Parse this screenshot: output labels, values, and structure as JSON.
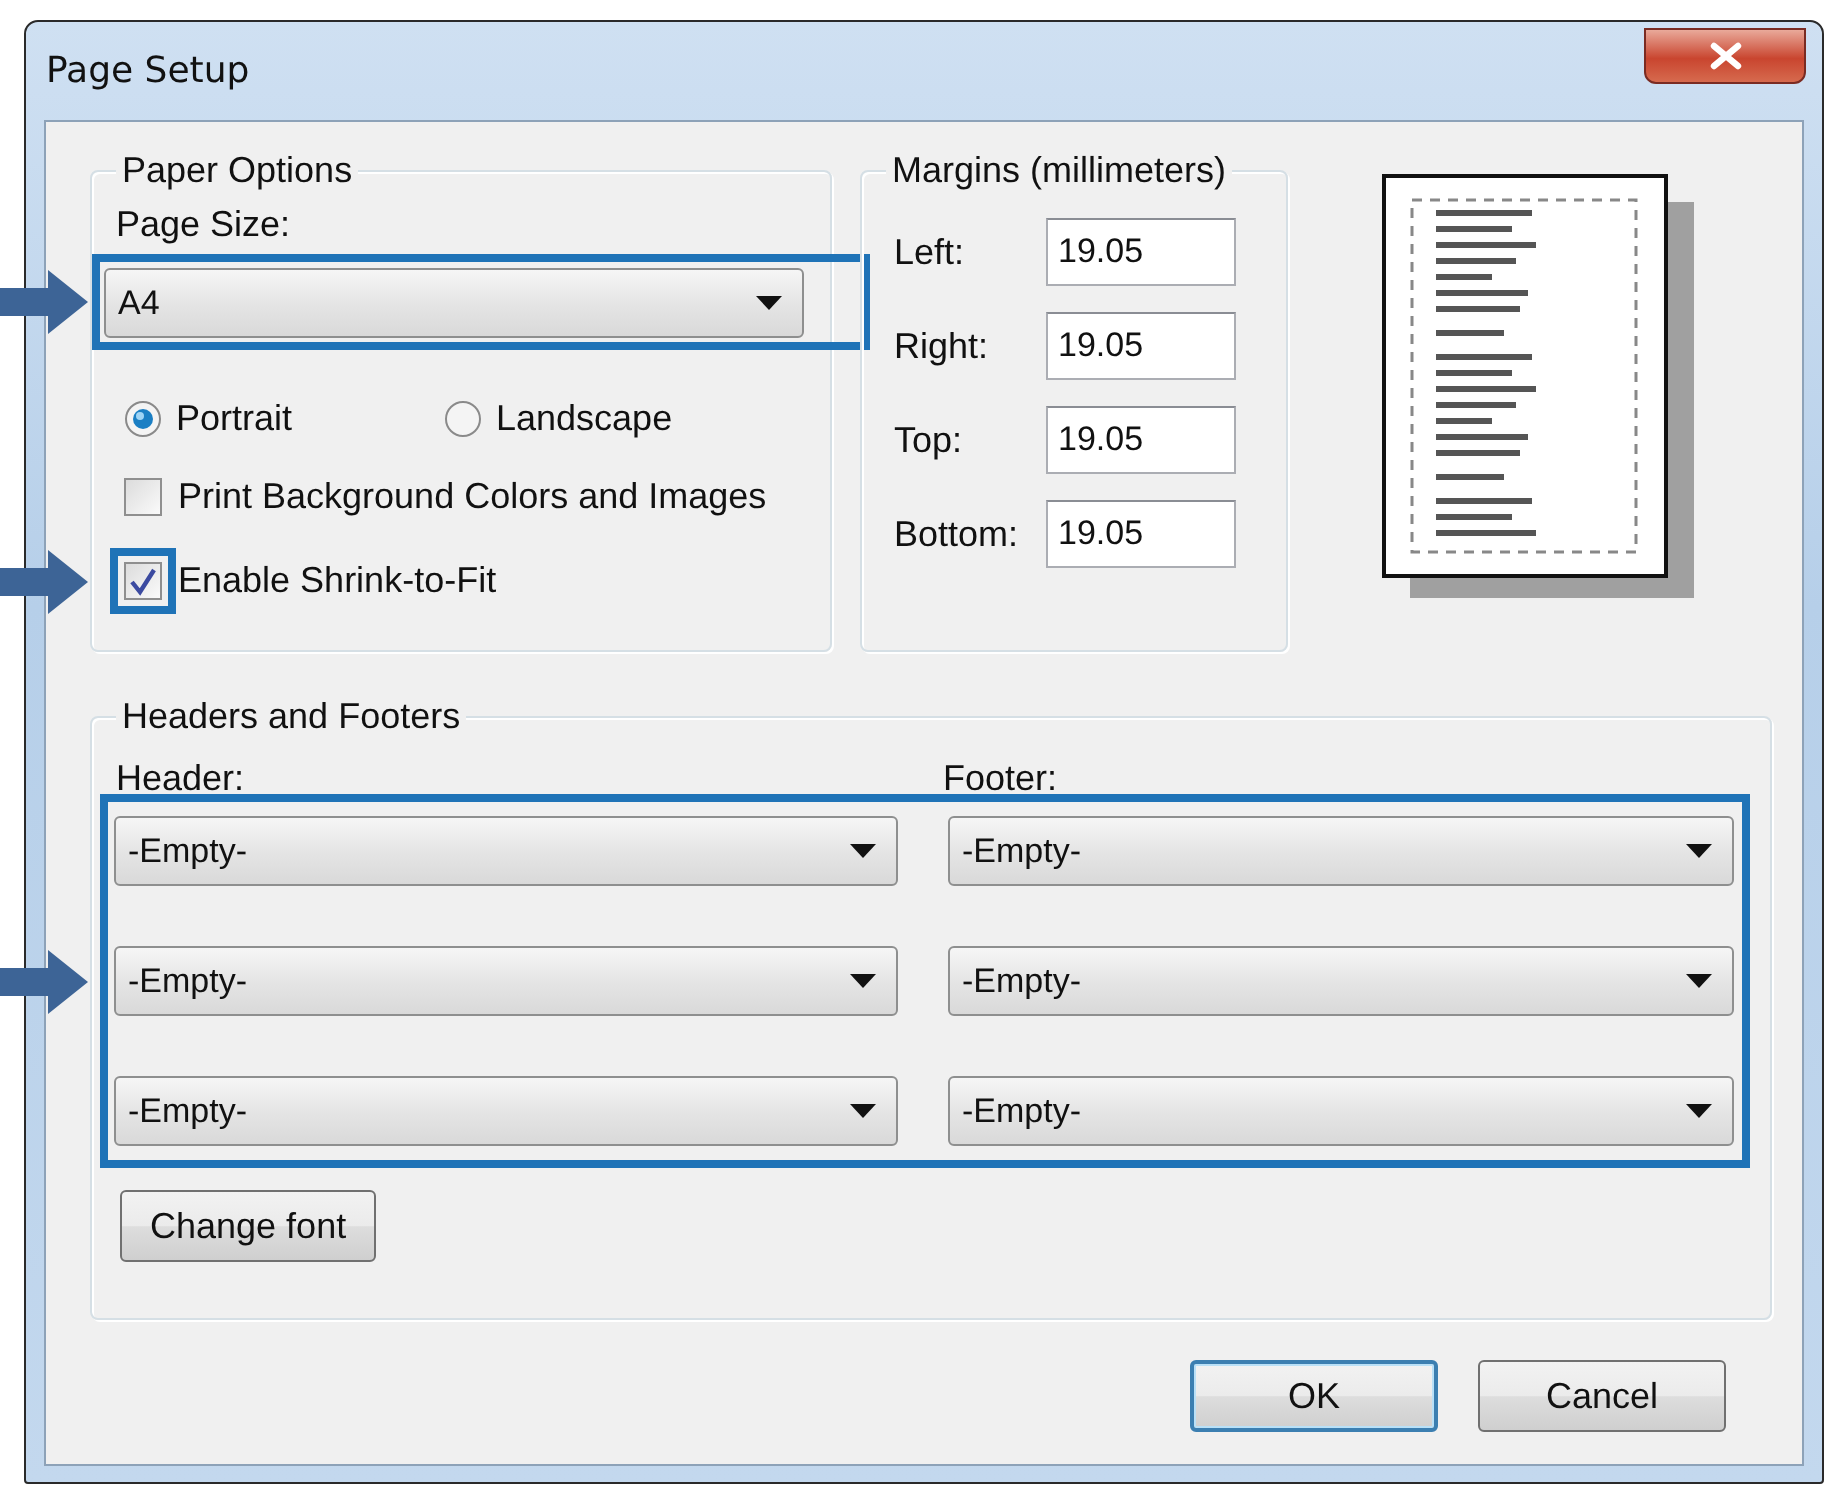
{
  "window": {
    "title": "Page Setup"
  },
  "paper_options": {
    "title": "Paper Options",
    "page_size_label": "Page Size:",
    "page_size": {
      "value": "A4",
      "highlighted": true
    },
    "orientation": [
      {
        "label": "Portrait",
        "selected": true
      },
      {
        "label": "Landscape",
        "selected": false
      }
    ],
    "options": [
      {
        "label": "Print Background Colors and Images",
        "checked": false,
        "highlighted": false
      },
      {
        "label": "Enable Shrink-to-Fit",
        "checked": true,
        "highlighted": true
      }
    ]
  },
  "margins": {
    "title": "Margins (millimeters)",
    "fields": [
      {
        "label": "Left:",
        "value": "19.05"
      },
      {
        "label": "Right:",
        "value": "19.05"
      },
      {
        "label": "Top:",
        "value": "19.05"
      },
      {
        "label": "Bottom:",
        "value": "19.05"
      }
    ]
  },
  "headers_footers": {
    "title": "Headers and Footers",
    "highlighted": true,
    "header_label": "Header:",
    "footer_label": "Footer:",
    "header": [
      "-Empty-",
      "-Empty-",
      "-Empty-"
    ],
    "footer": [
      "-Empty-",
      "-Empty-",
      "-Empty-"
    ],
    "change_font": "Change font"
  },
  "dialog_buttons": [
    {
      "label": "OK",
      "default": true
    },
    {
      "label": "Cancel",
      "default": false
    }
  ]
}
